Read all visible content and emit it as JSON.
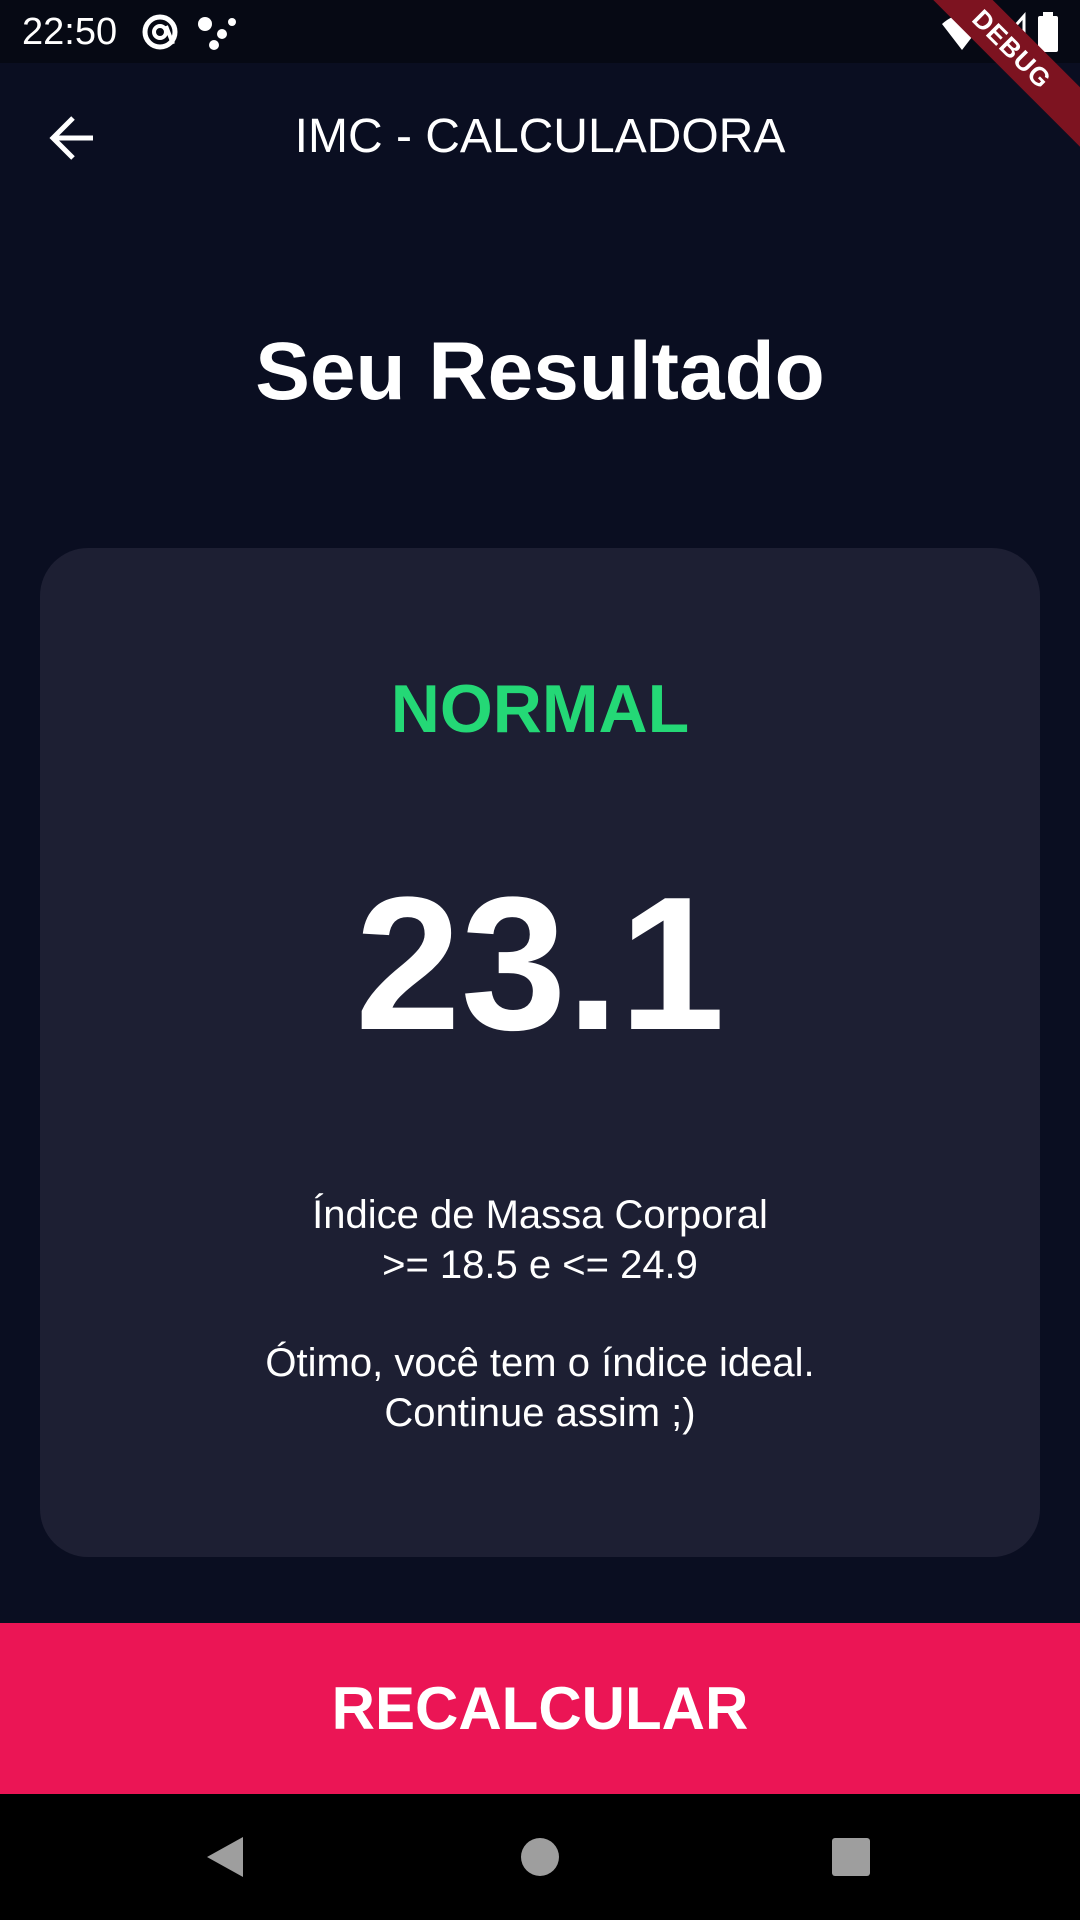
{
  "status_bar": {
    "time": "22:50",
    "icons": [
      "at-sign-icon",
      "assistant-dots-icon",
      "wifi-icon",
      "signal-icon",
      "battery-icon"
    ]
  },
  "debug_banner": "DEBUG",
  "app_bar": {
    "title": "IMC - CALCULADORA",
    "back_icon": "arrow-back-icon"
  },
  "heading": "Seu Resultado",
  "result": {
    "status": "NORMAL",
    "value": "23.1",
    "range_line1": "Índice de Massa Corporal",
    "range_line2": ">= 18.5 e <= 24.9",
    "message_line1": "Ótimo, você tem o índice ideal.",
    "message_line2": "Continue assim ;)"
  },
  "button": {
    "label": "RECALCULAR"
  },
  "nav_bar": {
    "icons": [
      "nav-back-icon",
      "nav-home-icon",
      "nav-recents-icon"
    ]
  },
  "colors": {
    "background": "#0a0e21",
    "card": "#1d1f33",
    "status_green": "#24d876",
    "accent_pink": "#eb1555",
    "debug_banner": "#7d1320"
  }
}
